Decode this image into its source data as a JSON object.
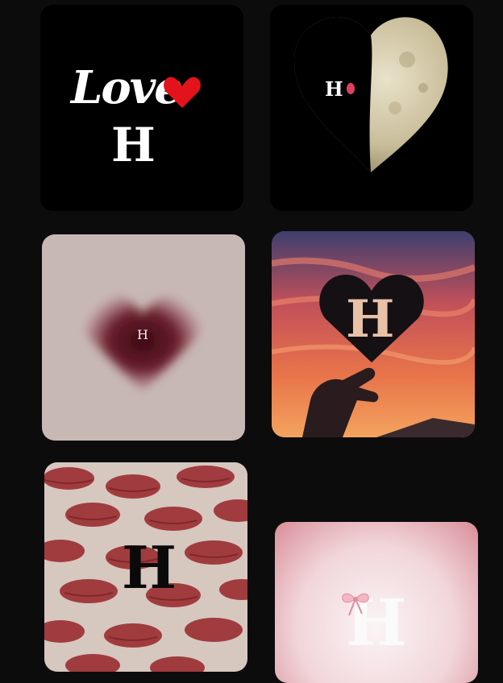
{
  "tiles": [
    {
      "name": "love-h-tile",
      "love_word": "Love",
      "letter": "H"
    },
    {
      "name": "moon-heart-tile",
      "letter": "H"
    },
    {
      "name": "blurred-heart-tile",
      "letter": "H"
    },
    {
      "name": "sunset-heart-tile",
      "letter": "H"
    },
    {
      "name": "lips-pattern-tile",
      "letter": "H"
    },
    {
      "name": "pink-bow-tile",
      "letter": "H"
    }
  ],
  "colors": {
    "background": "#0c0c0c",
    "heart_red": "#e3131b",
    "moon": "#d8cfb2",
    "soft_pink": "#f1dfe2"
  },
  "icons": [
    "heart-icon",
    "moon-heart-icon",
    "heart-cutout-icon",
    "bow-icon"
  ]
}
